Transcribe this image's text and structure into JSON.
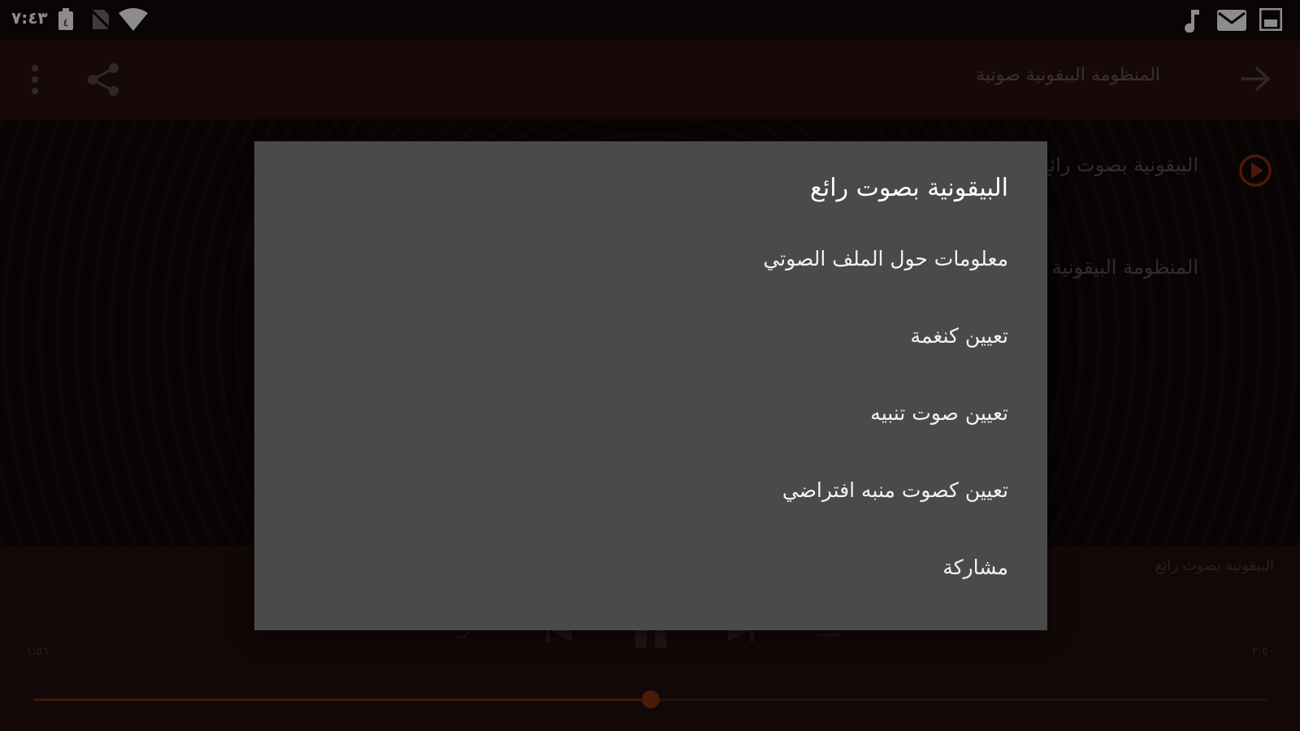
{
  "status_bar": {
    "time": "٧:٤٣"
  },
  "app_bar": {
    "title": "المنظومة البيقونية صوتية"
  },
  "track_list": [
    "البيقونية بصوت رائع",
    "المنظومة البيقونية"
  ],
  "player": {
    "now_playing": "البيقونية بصوت رائع",
    "elapsed": "١:٥٦",
    "duration": "٣:٥٠",
    "progress": 0.5
  },
  "dialog": {
    "title": "البيقونية بصوت رائع",
    "items": [
      "معلومات حول الملف الصوتي",
      "تعيين كنغمة",
      "تعيين صوت تنبيه",
      "تعيين كصوت منبه افتراضي",
      "مشاركة"
    ]
  },
  "colors": {
    "accent": "#c0451c",
    "dialog_bg": "#4a4a4a",
    "app_bar": "#2a1212"
  }
}
